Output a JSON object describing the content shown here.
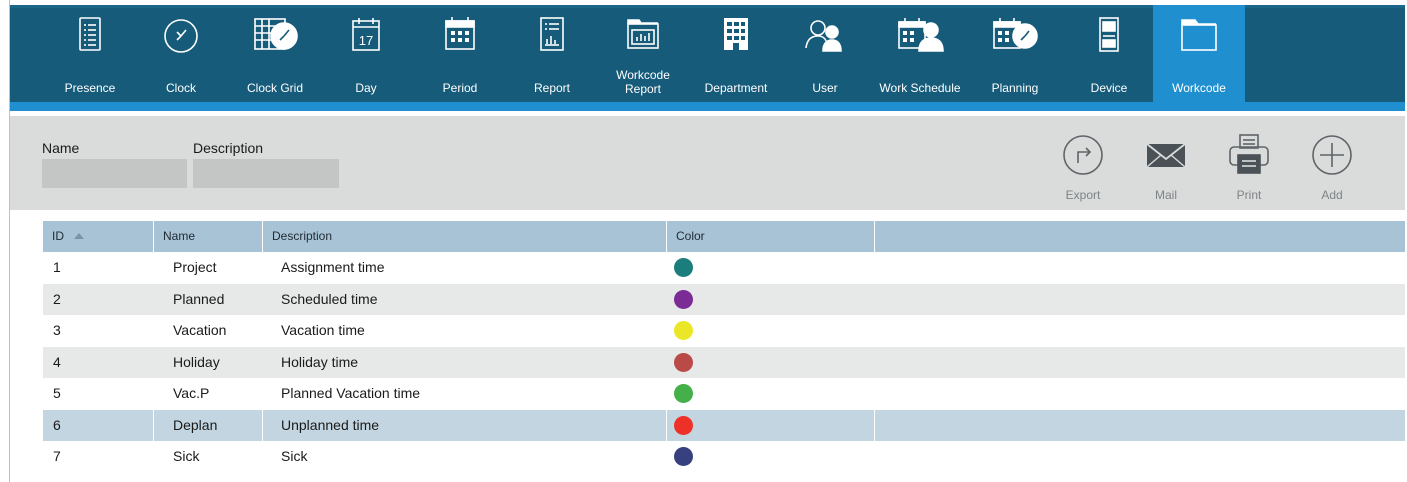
{
  "nav": {
    "items": [
      {
        "label": "Presence",
        "icon": "presence-icon"
      },
      {
        "label": "Clock",
        "icon": "clock-icon"
      },
      {
        "label": "Clock Grid",
        "icon": "clock-grid-icon"
      },
      {
        "label": "Day",
        "icon": "calendar-day-icon",
        "day_number": "17"
      },
      {
        "label": "Period",
        "icon": "calendar-period-icon"
      },
      {
        "label": "Report",
        "icon": "report-icon"
      },
      {
        "label": "Workcode\nReport",
        "icon": "workcode-report-icon"
      },
      {
        "label": "Department",
        "icon": "department-icon"
      },
      {
        "label": "User",
        "icon": "user-icon"
      },
      {
        "label": "Work Schedule",
        "icon": "work-schedule-icon"
      },
      {
        "label": "Planning",
        "icon": "planning-icon"
      },
      {
        "label": "Device",
        "icon": "device-icon"
      },
      {
        "label": "Workcode",
        "icon": "workcode-folder-icon"
      }
    ],
    "active_index": 12
  },
  "filters": {
    "name_label": "Name",
    "name_value": "",
    "description_label": "Description",
    "description_value": ""
  },
  "actions": {
    "export_label": "Export",
    "mail_label": "Mail",
    "print_label": "Print",
    "add_label": "Add"
  },
  "table": {
    "columns": {
      "id": "ID",
      "name": "Name",
      "description": "Description",
      "color": "Color"
    },
    "sort": {
      "column": "id",
      "direction": "ascending"
    },
    "selected_row_index": 5,
    "rows": [
      {
        "id": "1",
        "name": "Project",
        "description": "Assignment time",
        "color": "#1b7e7c"
      },
      {
        "id": "2",
        "name": "Planned",
        "description": "Scheduled time",
        "color": "#7a2b95"
      },
      {
        "id": "3",
        "name": "Vacation",
        "description": "Vacation time",
        "color": "#ece726"
      },
      {
        "id": "4",
        "name": "Holiday",
        "description": "Holiday time",
        "color": "#b94a48"
      },
      {
        "id": "5",
        "name": "Vac.P",
        "description": "Planned Vacation time",
        "color": "#43b049"
      },
      {
        "id": "6",
        "name": "Deplan",
        "description": "Unplanned time",
        "color": "#ee3128"
      },
      {
        "id": "7",
        "name": "Sick",
        "description": "Sick",
        "color": "#36407f"
      }
    ]
  },
  "theme": {
    "nav_background": "#165b7a",
    "active_tab": "#1f8fd0",
    "header_row": "#a8c3d6",
    "selected_row": "#c3d5e1"
  }
}
